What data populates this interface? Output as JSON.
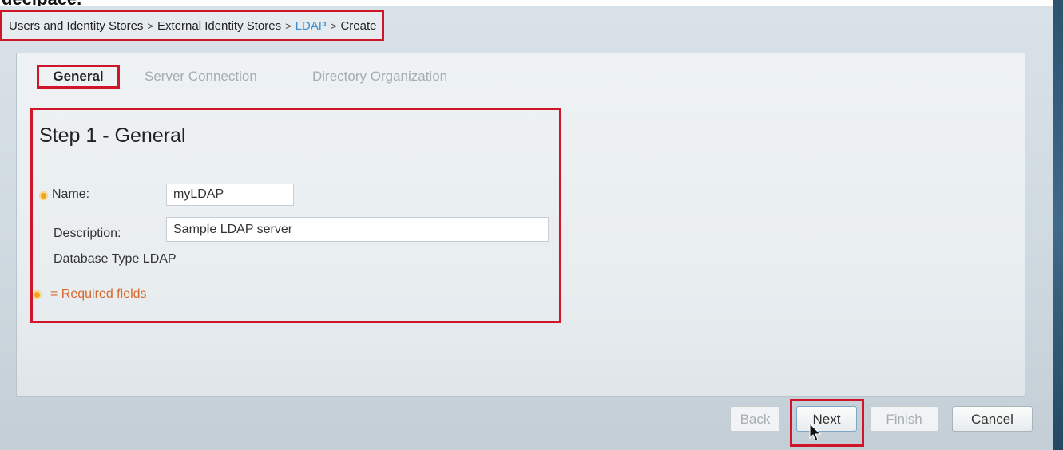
{
  "cropped_heading": "decipace.",
  "breadcrumb": {
    "items": [
      {
        "label": "Users and Identity Stores",
        "link": false
      },
      {
        "label": "External Identity Stores",
        "link": false
      },
      {
        "label": "LDAP",
        "link": true
      },
      {
        "label": "Create",
        "link": false
      }
    ],
    "separator": ">"
  },
  "tabs": [
    {
      "label": "General",
      "active": true
    },
    {
      "label": "Server Connection",
      "active": false
    },
    {
      "label": "Directory Organization",
      "active": false
    }
  ],
  "form": {
    "title": "Step 1 - General",
    "name_label": "Name:",
    "name_value": "myLDAP",
    "description_label": "Description:",
    "description_value": "Sample LDAP server",
    "db_type_label": "Database Type",
    "db_type_value": "LDAP",
    "required_note": "= Required fields"
  },
  "buttons": {
    "back": "Back",
    "next": "Next",
    "finish": "Finish",
    "cancel": "Cancel"
  },
  "icons": {
    "required": "required-field-icon",
    "cursor": "mouse-pointer-icon"
  },
  "colors": {
    "highlight": "#d0142a",
    "link": "#3a8fd0",
    "required": "#f1a21e",
    "required_text": "#d9662b"
  }
}
